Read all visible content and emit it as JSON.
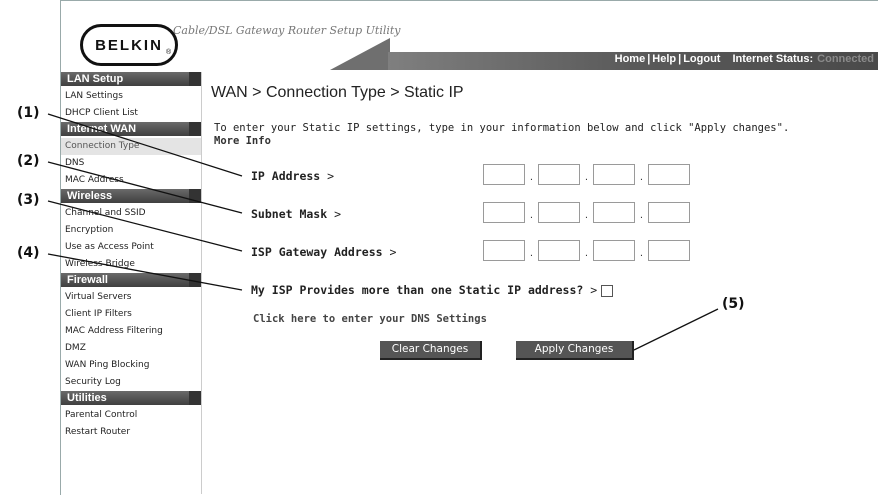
{
  "brand": {
    "logo_text": "BELKIN",
    "registered": "®",
    "subtitle": "Cable/DSL Gateway Router Setup Utility"
  },
  "topnav": {
    "home": "Home",
    "help": "Help",
    "logout": "Logout",
    "separator": "|",
    "status_label": "Internet Status:",
    "status_value": "Connected"
  },
  "sidebar": [
    {
      "heading": "LAN Setup",
      "items": [
        "LAN Settings",
        "DHCP Client List"
      ]
    },
    {
      "heading": "Internet WAN",
      "items": [
        "Connection Type",
        "DNS",
        "MAC Address"
      ]
    },
    {
      "heading": "Wireless",
      "items": [
        "Channel and SSID",
        "Encryption",
        "Use as Access Point",
        "Wireless Bridge"
      ]
    },
    {
      "heading": "Firewall",
      "items": [
        "Virtual Servers",
        "Client IP Filters",
        "MAC Address Filtering",
        "DMZ",
        "WAN Ping Blocking",
        "Security Log"
      ]
    },
    {
      "heading": "Utilities",
      "items": [
        "Parental Control",
        "Restart Router"
      ]
    }
  ],
  "active_item": "Connection Type",
  "main": {
    "title": "WAN > Connection Type > Static IP",
    "intro": "To enter your Static IP settings, type in your information below and click \"Apply changes\".",
    "more_info": "More Info",
    "fields": {
      "ip": "IP Address",
      "subnet": "Subnet Mask",
      "gateway": "ISP Gateway Address",
      "gt": " >"
    },
    "multi_ip": "My ISP Provides more than one Static IP address?",
    "multi_ip_gt": " >",
    "dns_link": "Click here to enter your DNS Settings",
    "clear_button": "Clear Changes",
    "apply_button": "Apply Changes"
  },
  "callouts": [
    "(1)",
    "(2)",
    "(3)",
    "(4)",
    "(5)"
  ]
}
